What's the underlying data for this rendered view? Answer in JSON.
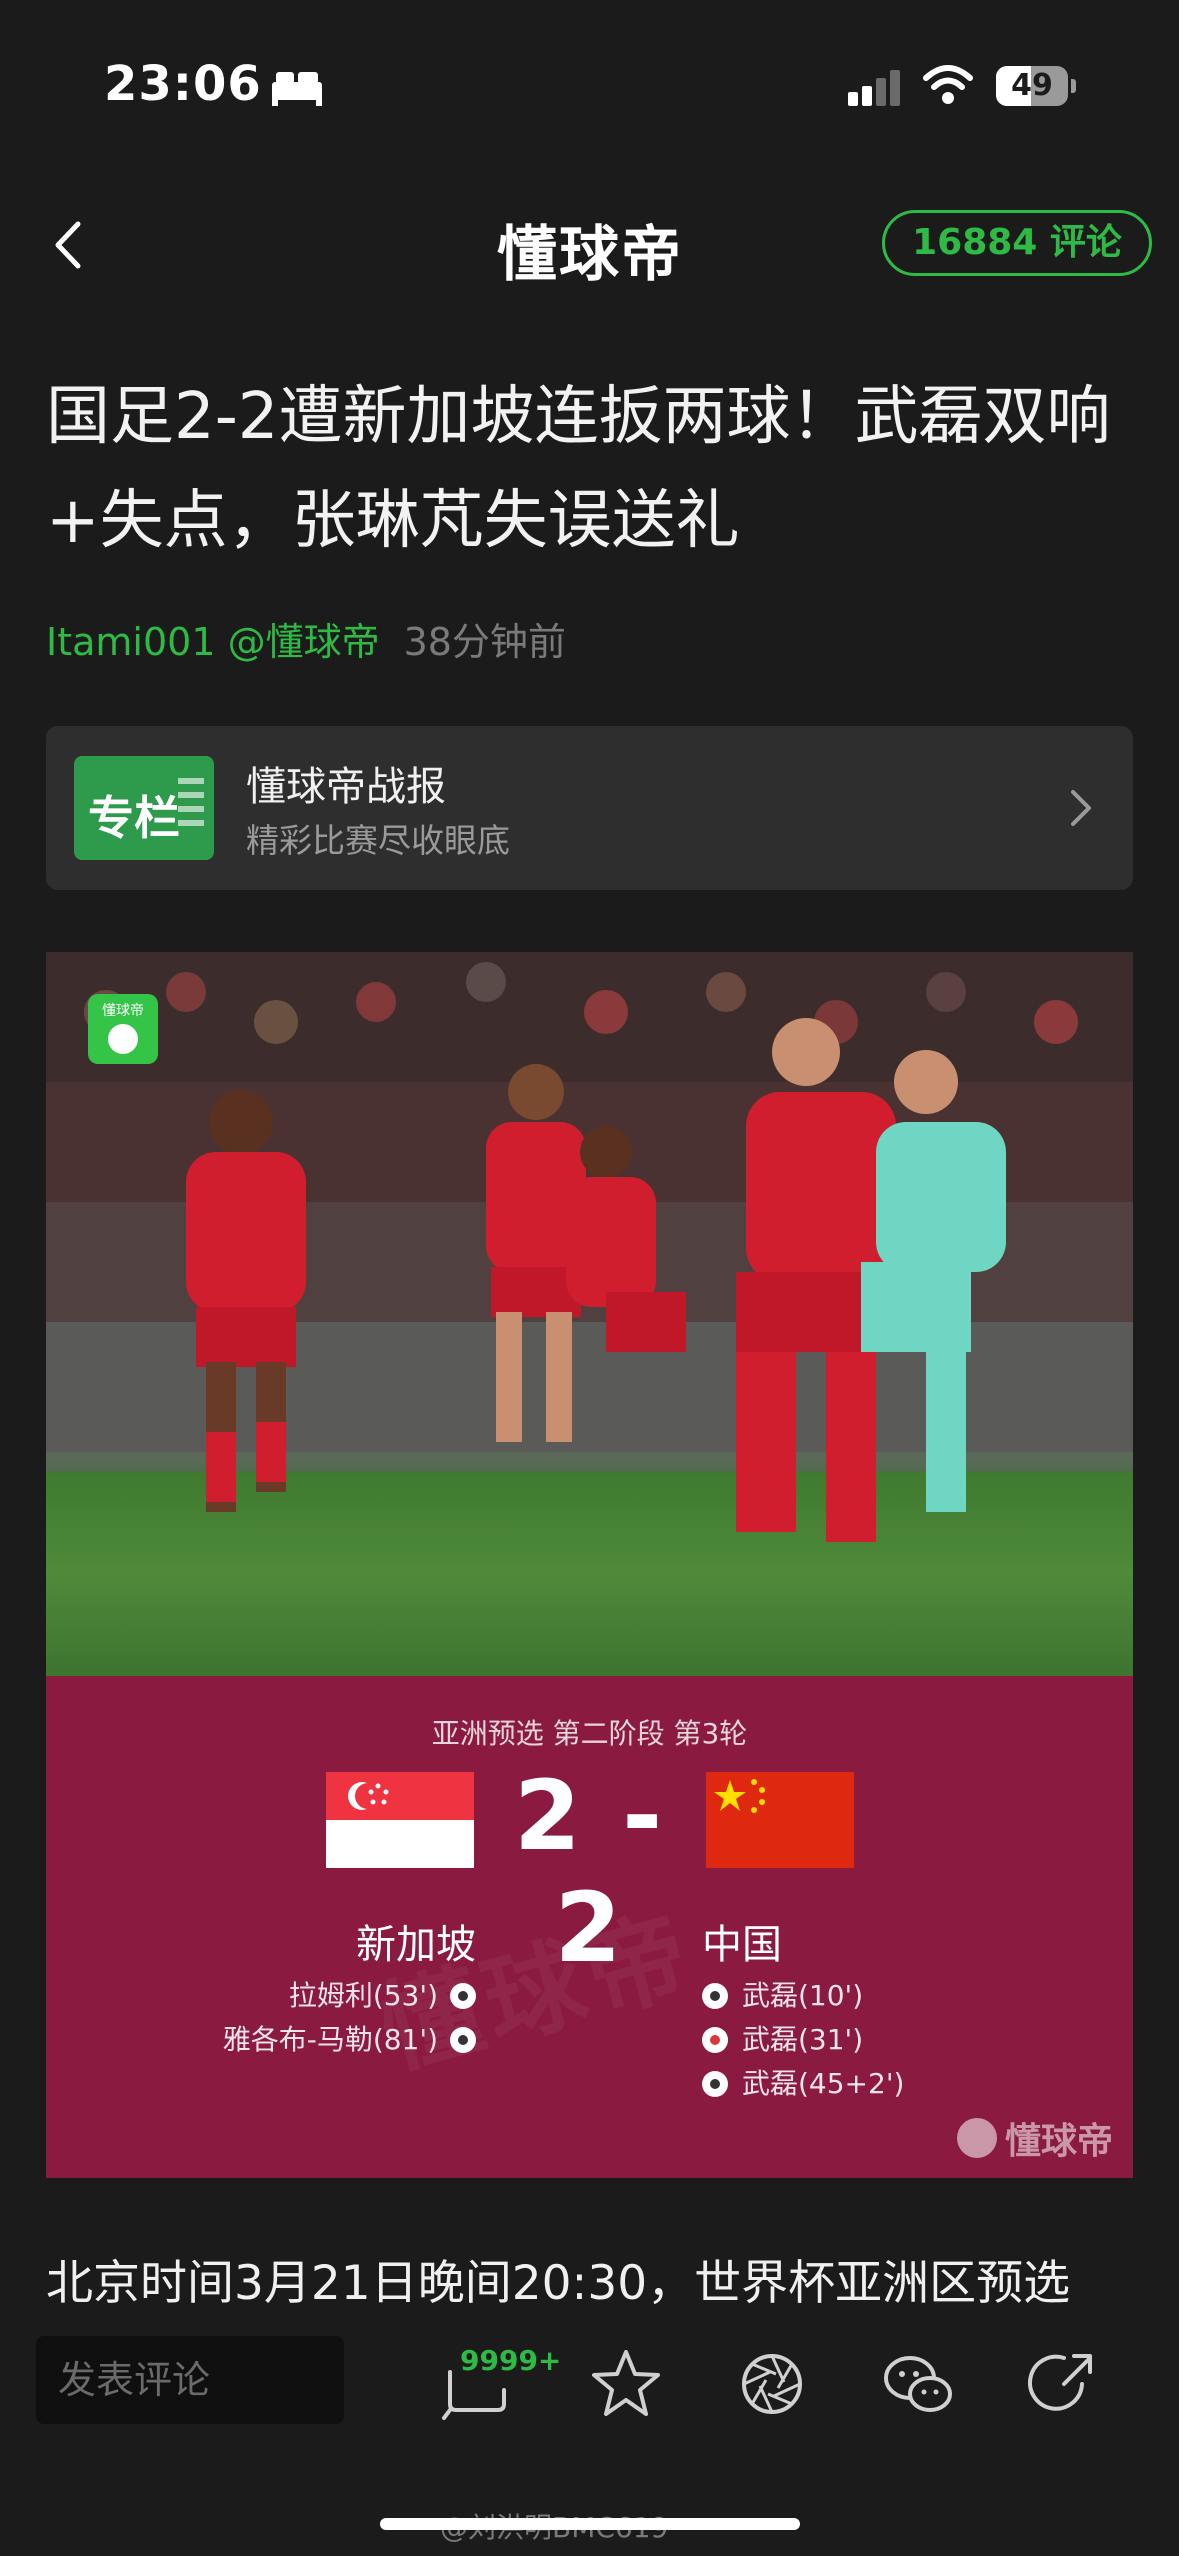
{
  "status_bar": {
    "time": "23:06",
    "battery_level": "49",
    "battery_fraction": 0.49
  },
  "header": {
    "logo": "懂球帝",
    "comment_count_label": "16884 评论"
  },
  "article": {
    "title": "国足2-2遭新加坡连扳两球！武磊双响+失点，张琳芃失误送礼",
    "author": "Itami001 @懂球帝",
    "time_ago": "38分钟前",
    "first_line": "北京时间3月21日晚间20:30，世界杯亚洲区预选"
  },
  "column_card": {
    "badge": "专栏",
    "title": "懂球帝战报",
    "subtitle": "精彩比赛尽收眼底"
  },
  "photo": {
    "logo_text": "懂球帝"
  },
  "scoreboard": {
    "stage": "亚洲预选  第二阶段  第3轮",
    "score": "2 - 2",
    "home_team": "新加坡",
    "away_team": "中国",
    "home_scorers": [
      "拉姆利(53')",
      "雅各布-马勒(81')"
    ],
    "away_scorers": [
      "武磊(10')",
      "武磊(31')",
      "武磊(45+2')"
    ],
    "watermark": "懂球帝"
  },
  "toolbar": {
    "comment_placeholder": "发表评论",
    "comment_count": "9999+"
  },
  "overlay": {
    "weibo_watermark": "@刘洪明BMC619"
  },
  "colors": {
    "accent_green": "#2dbb45",
    "scoreboard_bg": "#8a1a40",
    "background": "#1b1b1b"
  },
  "icons": [
    "back-arrow-icon",
    "chevron-right-icon",
    "comment-icon",
    "star-icon",
    "aperture-icon",
    "wechat-icon",
    "share-icon",
    "wifi-icon",
    "signal-icon",
    "sleep-icon",
    "soccer-ball-icon"
  ]
}
